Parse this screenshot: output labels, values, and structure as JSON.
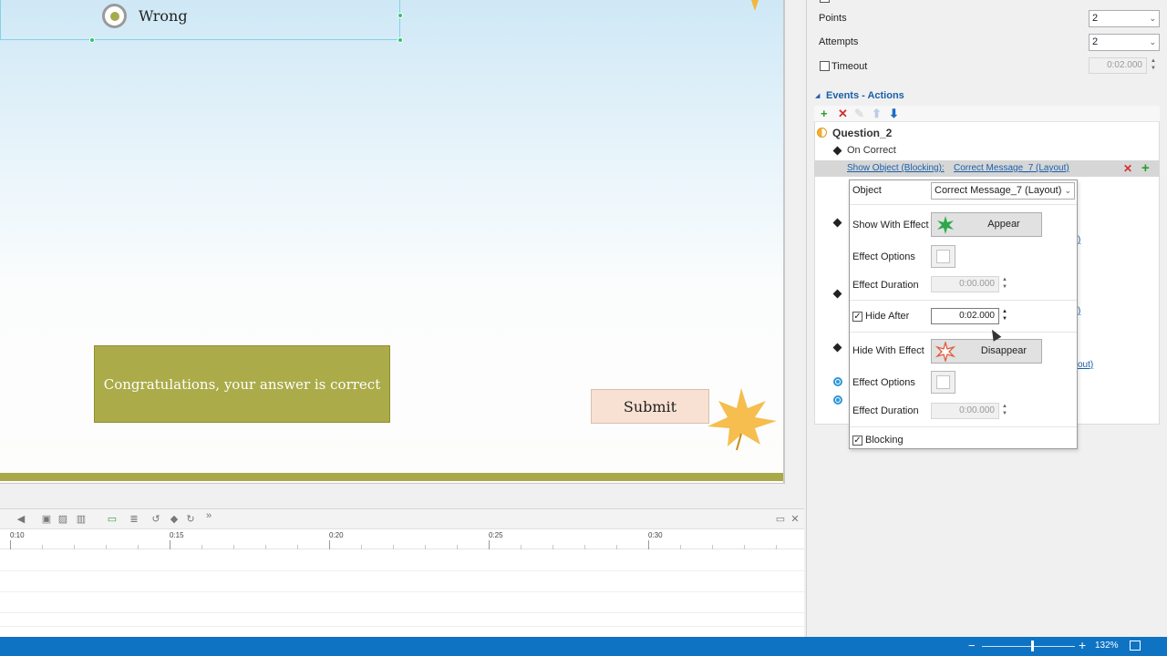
{
  "slide": {
    "wrong_label": "Wrong",
    "congrats_text": "Congratulations, your answer is correct",
    "submit_label": "Submit",
    "accent_color": "#abab4a"
  },
  "timeline": {
    "ticks": [
      "0:10",
      "0:15",
      "0:20",
      "0:25",
      "0:30"
    ],
    "more_glyph": "»"
  },
  "status": {
    "zoom_minus": "−",
    "zoom_plus": "+",
    "zoom": "132%",
    "zoom_level_fraction": 0.53
  },
  "panel": {
    "points_label": "Points",
    "points_value": "2",
    "attempts_label": "Attempts",
    "attempts_value": "2",
    "timeout_label": "Timeout",
    "timeout_value": "0:02.000",
    "events_section": "Events - Actions",
    "question": "Question_2",
    "on_correct": "On Correct",
    "action_type": "Show Object (Blocking):",
    "action_target": "Correct Message_7 (Layout)",
    "bg_link_1": ")",
    "bg_link_2": ")",
    "bg_link_3": "out)"
  },
  "popup": {
    "object_label": "Object",
    "object_value": "Correct Message_7 (Layout)",
    "show_effect_label": "Show With Effect",
    "show_effect_value": "Appear",
    "effect_options_label": "Effect Options",
    "effect_duration_label": "Effect Duration",
    "effect_duration_value": "0:00.000",
    "hide_after_label": "Hide After",
    "hide_after_value": "0:02.000",
    "hide_effect_label": "Hide With Effect",
    "hide_effect_value": "Disappear",
    "effect_options_label_2": "Effect Options",
    "effect_duration_label_2": "Effect Duration",
    "effect_duration_value_2": "0:00.000",
    "blocking_label": "Blocking"
  }
}
